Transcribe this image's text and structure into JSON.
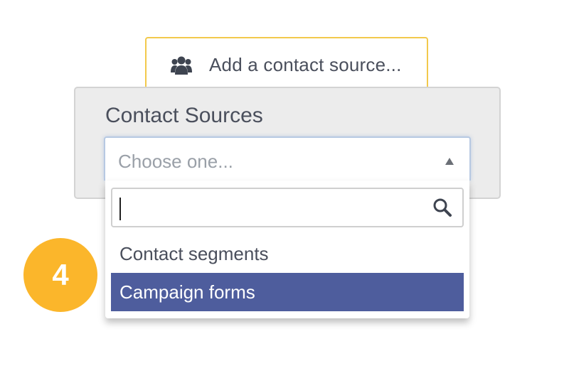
{
  "add_source": {
    "label": "Add a contact source...",
    "icon": "users-icon"
  },
  "panel": {
    "title": "Contact Sources"
  },
  "select": {
    "placeholder": "Choose one...",
    "arrow_icon": "triangle-up-icon"
  },
  "search": {
    "value": "",
    "icon": "search-icon"
  },
  "options": [
    {
      "label": "Contact segments",
      "highlighted": false
    },
    {
      "label": "Campaign forms",
      "highlighted": true
    }
  ],
  "step_badge": {
    "number": "4"
  },
  "colors": {
    "accent_yellow": "#f2c94c",
    "badge": "#fbb62b",
    "highlight": "#4e5d9d",
    "panel_bg": "#ececec",
    "text": "#4a4f5c"
  }
}
